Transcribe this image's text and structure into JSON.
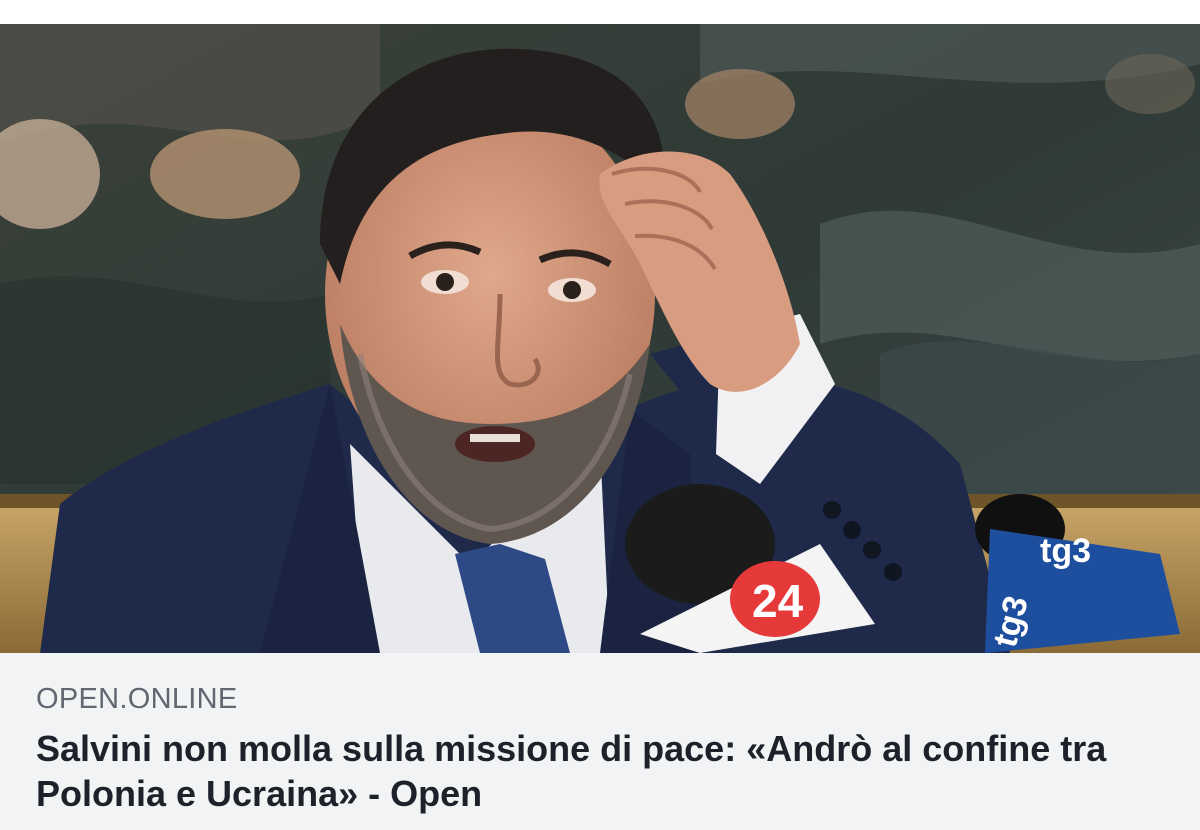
{
  "link_preview": {
    "image_icon": "press-conference-photo",
    "microphones": {
      "left_label": "24",
      "right_label": "tg3",
      "right_vertical_label": "tg3"
    },
    "source": "OPEN.ONLINE",
    "headline": "Salvini non molla sulla missione di pace: «Andrò al confine tra Polonia e Ucraina» - Open"
  },
  "colors": {
    "caption_background": "#f2f3f5",
    "source_text": "#606770",
    "headline_text": "#1d2129",
    "suit": "#1f2a4a",
    "tg3_blue": "#1e4f9e",
    "rai24_red": "#e63a3a"
  }
}
